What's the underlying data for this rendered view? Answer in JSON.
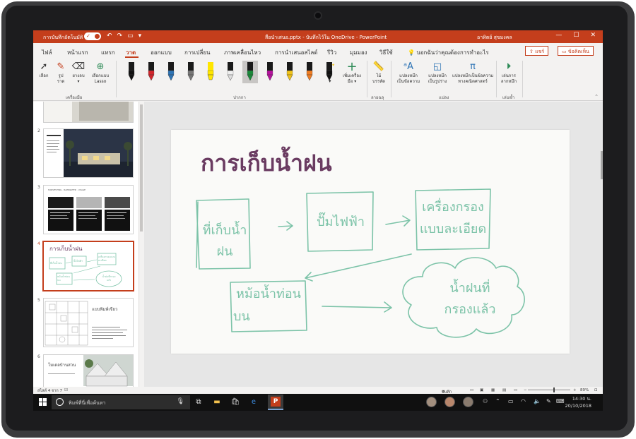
{
  "window": {
    "autosave_label": "การบันทึกอัตโนมัติ",
    "toggle_state": "on",
    "doc_title": "สื่อนำเสนอ.pptx - บันทึกไว้ใน OneDrive - PowerPoint",
    "user_name": "อาทิตย์ สุขมงคล",
    "controls": {
      "minimize": "—",
      "maximize": "☐",
      "close": "✕"
    },
    "qat": {
      "undo": "↶",
      "redo": "↷",
      "present": "▭",
      "more": "▾"
    }
  },
  "tabs": {
    "items": [
      "ไฟล์",
      "หน้าแรก",
      "แทรก",
      "วาด",
      "ออกแบบ",
      "การเปลี่ยน",
      "ภาพเคลื่อนไหว",
      "การนำเสนอสไลด์",
      "รีวิว",
      "มุมมอง",
      "วิธีใช้"
    ],
    "active": "วาด",
    "tell_me": "บอกฉันว่าคุณต้องการทำอะไร",
    "share": "แชร์",
    "comments": "ข้อคิดเห็น"
  },
  "ribbon": {
    "tools": {
      "select": "เลือก",
      "lasso_line1": "รูป",
      "lasso_line2": "ราด",
      "eraser": "ยางลบ",
      "lasso_select_line1": "เลือกแบบ",
      "lasso_select_line2": "Lasso",
      "group_label": "เครื่องมือ"
    },
    "pens": {
      "colors": [
        "#111111",
        "#d2262c",
        "#2e74b5",
        "#777777",
        "#ffe600",
        "#eeeeee",
        "#1a8a3a",
        "#b6129e",
        "#f0c21a",
        "#ef7d22",
        "#111111"
      ],
      "types": [
        "pen",
        "pen",
        "pen",
        "pencil",
        "highlighter",
        "pen",
        "pen",
        "pen",
        "pen",
        "pen",
        "sparkle"
      ],
      "group_label": "ปากกา",
      "add_pen_line1": "เพิ่มเครื่อง",
      "add_pen_line2": "มือ"
    },
    "stencils": {
      "ruler_line1": "ไม้",
      "ruler_line2": "บรรทัด",
      "group_label": "ลายฉลุ"
    },
    "convert": {
      "ink_to_text_line1": "แปลงหมึก",
      "ink_to_text_line2": "เป็นข้อความ",
      "ink_to_shape_line1": "แปลงหมึก",
      "ink_to_shape_line2": "เป็นรูปร่าง",
      "ink_to_math_line1": "แปลงหมึกเป็นข้อความ",
      "ink_to_math_line2": "ทางคณิตศาสตร์",
      "group_label": "แปลง"
    },
    "replay": {
      "label_line1": "เล่นการ",
      "label_line2": "ลากหมึก",
      "group_label": "เล่นซ้ำ"
    }
  },
  "thumbnails": {
    "numbers": [
      "2",
      "3",
      "4",
      "5",
      "6"
    ],
    "slide3_header": "HARVESTING · RAINWATER · USAGE",
    "slide4_title": "การเก็บน้ำฝน",
    "slide4_texts": [
      "ที่เก็บน้ำฝน",
      "ปั๊มไฟฟ้า",
      "เครื่องกรองแบบละเอียด",
      "หม้อน้ำท่อนบน",
      "น้ำฝนที่กรองแล้ว"
    ],
    "slide5_title": "แบบพิมพ์เขียว",
    "slide6_title": "โมเดลบ้านสวน"
  },
  "slide": {
    "title": "การเก็บน้ำฝน",
    "box1": "ที่เก็บน้ำฝน",
    "box2": "ปั๊มไฟฟ้า",
    "box3_line1": "เครื่องกรอง",
    "box3_line2": "แบบละเอียด",
    "box4_line1": "หม้อน้ำท่อน",
    "box4_line2": "บน",
    "cloud_line1": "น้ำฝนที่",
    "cloud_line2": "กรองแล้ว",
    "ink_color": "#7cc3a8",
    "title_color": "#6a3b61"
  },
  "status": {
    "slide_info": "สไลด์ 4 จาก 7",
    "notes": "บันทึกย่อ",
    "zoom": "89%"
  },
  "taskbar": {
    "search_placeholder": "พิมพ์ที่นี่เพื่อค้นหา",
    "time": "14:30 น.",
    "date": "20/10/2018",
    "app_icons": [
      "task-view",
      "file-explorer",
      "store",
      "edge",
      "powerpoint"
    ]
  }
}
